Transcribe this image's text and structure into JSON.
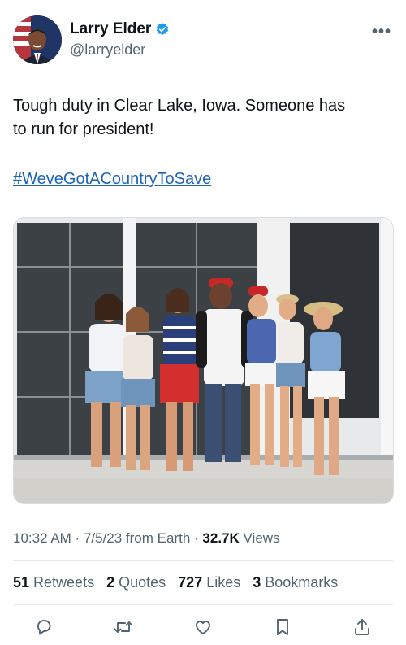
{
  "author": {
    "display_name": "Larry Elder",
    "handle": "@larryelder",
    "avatar_icon": "profile-photo",
    "verified_color": "#1d9bf0"
  },
  "more_label": "•••",
  "tweet": {
    "text_line1": "Tough duty in Clear Lake, Iowa. Someone has",
    "text_line2": "to run for president!",
    "hashtag": "#WeveGotACountryToSave"
  },
  "media": {
    "type": "photo",
    "description_icon": "group-photo"
  },
  "meta": {
    "time": "10:32 AM",
    "dot1": " · ",
    "date": "7/5/23",
    "source": " from Earth",
    "dot2": " · ",
    "views_count": "32.7K",
    "views_label": " Views"
  },
  "stats": {
    "retweets_count": "51",
    "retweets_label": " Retweets",
    "quotes_count": "2",
    "quotes_label": " Quotes",
    "likes_count": "727",
    "likes_label": " Likes",
    "bookmarks_count": "3",
    "bookmarks_label": " Bookmarks"
  },
  "actions": [
    "reply-icon",
    "retweet-icon",
    "like-icon",
    "bookmark-icon",
    "share-icon"
  ],
  "colors": {
    "text": "#0f1419",
    "secondary": "#536471",
    "link": "#1d64b8",
    "divider": "#e6e9ec"
  }
}
